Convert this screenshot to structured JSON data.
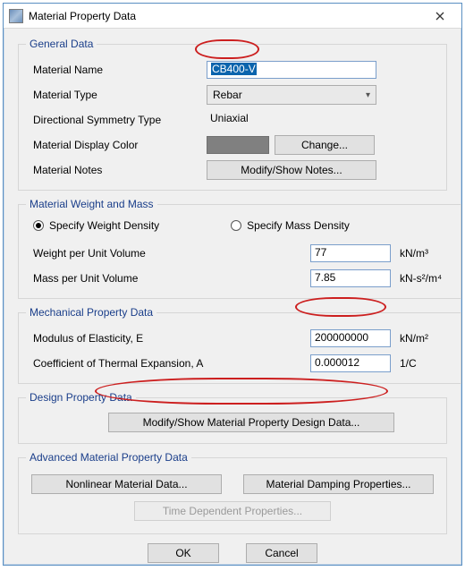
{
  "title": "Material Property Data",
  "groups": {
    "general": "General Data",
    "weight": "Material Weight and Mass",
    "mech": "Mechanical Property Data",
    "design": "Design Property Data",
    "adv": "Advanced Material Property Data"
  },
  "labels": {
    "materialName": "Material Name",
    "materialType": "Material Type",
    "directionalSymmetry": "Directional Symmetry Type",
    "displayColor": "Material Display Color",
    "materialNotes": "Material Notes",
    "weightPerUnit": "Weight per Unit Volume",
    "massPerUnit": "Mass per Unit Volume",
    "modulus": "Modulus of Elasticity,  E",
    "thermal": "Coefficient of Thermal Expansion,  A"
  },
  "radios": {
    "weightDensity": "Specify Weight Density",
    "massDensity": "Specify Mass Density"
  },
  "buttons": {
    "change": "Change...",
    "modifyNotes": "Modify/Show Notes...",
    "designData": "Modify/Show Material Property Design Data...",
    "nonlinear": "Nonlinear Material Data...",
    "damping": "Material Damping Properties...",
    "timeDep": "Time Dependent Properties...",
    "ok": "OK",
    "cancel": "Cancel"
  },
  "values": {
    "materialName": "CB400-V",
    "materialType": "Rebar",
    "directionalSymmetry": "Uniaxial",
    "weightPerUnit": "77",
    "massPerUnit": "7.85",
    "modulus": "200000000",
    "thermal": "0.000012"
  },
  "units": {
    "weightPerUnit": "kN/m³",
    "massPerUnit": "kN-s²/m⁴",
    "modulus": "kN/m²",
    "thermal": "1/C"
  }
}
